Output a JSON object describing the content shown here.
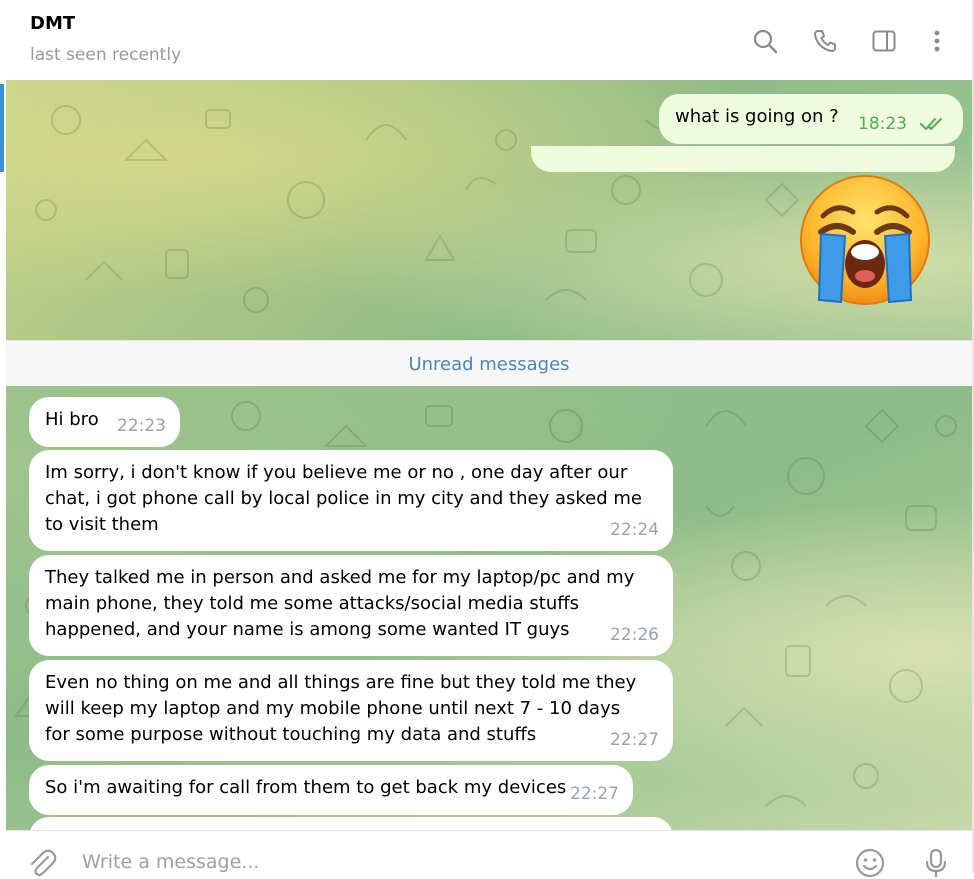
{
  "header": {
    "name": "DMT",
    "status": "last seen recently",
    "icons": [
      "search-icon",
      "phone-icon",
      "sidebar-toggle-icon",
      "more-vertical-icon"
    ]
  },
  "messages_top": [
    {
      "direction": "out",
      "text": "what is going on ?",
      "time": "18:23",
      "status": "read"
    }
  ],
  "sticker": {
    "emoji": "loudly-crying-face"
  },
  "unread": {
    "label": "Unread messages"
  },
  "messages": [
    {
      "text": "Hi bro",
      "time": "22:23"
    },
    {
      "text": "Im sorry, i don't know if you believe me or no , one day after our chat, i got phone call by local police in my city and they asked me to visit them",
      "time": "22:24"
    },
    {
      "text": "They talked me in person and asked me for my laptop/pc and my main phone, they told me some attacks/social media stuffs happened, and your name is among some wanted IT guys",
      "time": "22:26"
    },
    {
      "text": "Even no thing on me and all things are fine but they told me they will keep my laptop and my mobile phone until next 7 - 10 days for some purpose without touching my data and stuffs",
      "time": "22:27"
    },
    {
      "text": "So i'm awaiting for call from them to get back my devices",
      "time": "22:27"
    }
  ],
  "composer": {
    "placeholder": "Write a message...",
    "icons": [
      "attach-icon",
      "emoji-icon",
      "microphone-icon"
    ]
  },
  "colors": {
    "accent": "#4a87b8",
    "outgoing_bubble": "#effdde",
    "incoming_bubble": "#ffffff",
    "read_check": "#4fae4e"
  }
}
